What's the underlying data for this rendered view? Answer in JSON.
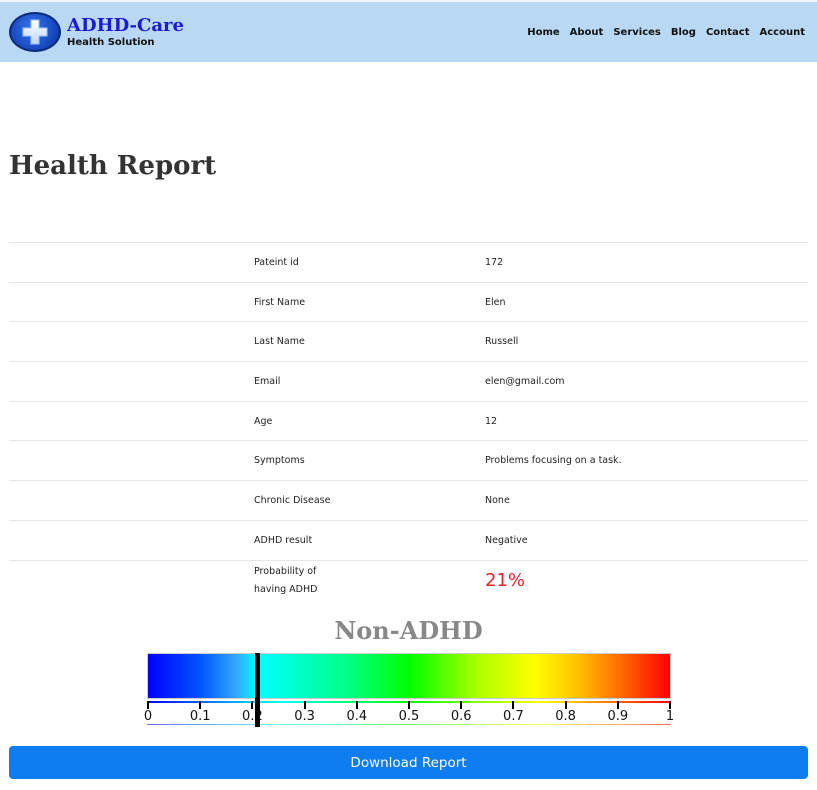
{
  "brand": {
    "name": "ADHD-Care",
    "tagline": "Health Solution",
    "logo_icon": "medical-cross-icon"
  },
  "nav": {
    "items": [
      "Home",
      "About",
      "Services",
      "Blog",
      "Contact",
      "Account"
    ]
  },
  "page": {
    "title": "Health Report"
  },
  "report": {
    "rows": [
      {
        "label": "Pateint id",
        "value": "172"
      },
      {
        "label": "First Name",
        "value": "Elen"
      },
      {
        "label": "Last Name",
        "value": "Russell"
      },
      {
        "label": "Email",
        "value": "elen@gmail.com"
      },
      {
        "label": "Age",
        "value": "12"
      },
      {
        "label": "Symptoms",
        "value": "Problems focusing on a task."
      },
      {
        "label": "Chronic Disease",
        "value": "None"
      },
      {
        "label": "ADHD result",
        "value": "Negative"
      }
    ],
    "probability_label": "Probability of having ADHD",
    "probability_value": "21%"
  },
  "gauge": {
    "title": "Non-ADHD",
    "value": 0.21,
    "tick_labels": [
      "0",
      "0.1",
      "0.2",
      "0.3",
      "0.4",
      "0.5",
      "0.6",
      "0.7",
      "0.8",
      "0.9",
      "1"
    ],
    "colors": [
      "#0000ff",
      "#00ffff",
      "#00ff00",
      "#ffff00",
      "#ff0000"
    ]
  },
  "actions": {
    "download_label": "Download Report"
  },
  "colors": {
    "navbar_bg": "#b8d8f3",
    "brand_name": "#1a1ad8",
    "probability": "#e8222a",
    "button": "#0d7df0"
  }
}
